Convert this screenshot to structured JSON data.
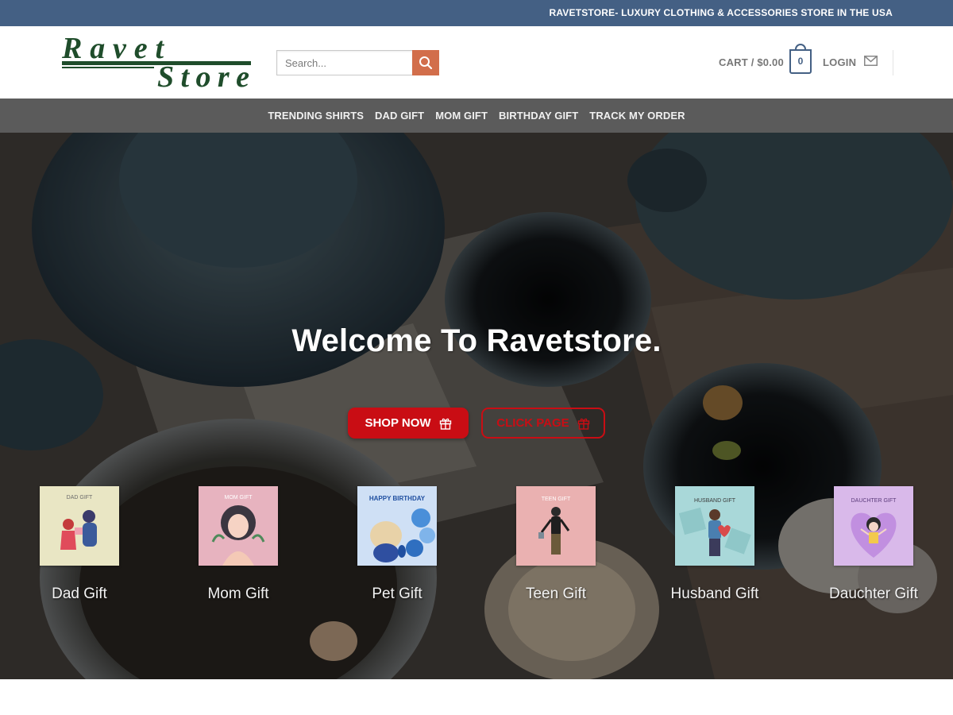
{
  "topbar": {
    "text": "RAVETSTORE- LUXURY CLOTHING & ACCESSORIES STORE IN THE USA"
  },
  "header": {
    "logo": {
      "line1": "Ravet",
      "line2": "Store"
    },
    "search": {
      "placeholder": "Search..."
    },
    "cart": {
      "label": "CART / $0.00",
      "count": "0"
    },
    "login_label": "LOGIN"
  },
  "nav": {
    "items": [
      {
        "label": "TRENDING SHIRTS"
      },
      {
        "label": "DAD GIFT"
      },
      {
        "label": "MOM GIFT"
      },
      {
        "label": "BIRTHDAY GIFT"
      },
      {
        "label": "TRACK MY ORDER"
      }
    ]
  },
  "hero": {
    "title": "Welcome To Ravetstore.",
    "shop_now_label": "SHOP NOW",
    "click_page_label": "CLICK PAGE"
  },
  "categories": [
    {
      "label": "Dad Gift",
      "thumb_text": "DAD GIFT",
      "thumb_color": "#e9e6c4",
      "icon": "dad-gift-image"
    },
    {
      "label": "Mom Gift",
      "thumb_text": "MOM GIFT",
      "thumb_color": "#e7b3bf",
      "icon": "mom-gift-image"
    },
    {
      "label": "Pet Gift",
      "thumb_text": "HAPPY BIRTHDAY",
      "thumb_color": "#cfe0f5",
      "icon": "pet-gift-image"
    },
    {
      "label": "Teen Gift",
      "thumb_text": "TEEN GIFT",
      "thumb_color": "#eab1b1",
      "icon": "teen-gift-image"
    },
    {
      "label": "Husband Gift",
      "thumb_text": "HUSBAND GIFT",
      "thumb_color": "#a9d8d9",
      "icon": "husband-gift-image"
    },
    {
      "label": "Dauchter Gift",
      "thumb_text": "DAUCHTER GIFT",
      "thumb_color": "#d9b9ea",
      "icon": "daughter-gift-image"
    }
  ],
  "colors": {
    "topbar": "#446084",
    "search_button": "#d26e4b",
    "navbar": "#5b5b5b",
    "primary_red": "#c90d14",
    "logo_green": "#1f4d2b"
  }
}
